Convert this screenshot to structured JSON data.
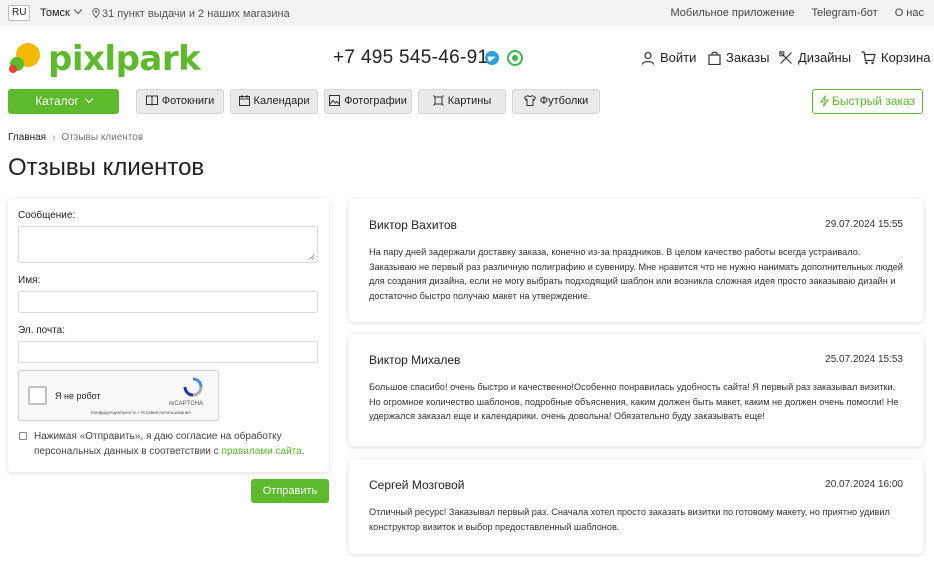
{
  "topbar": {
    "lang": "RU",
    "city": "Томск",
    "pickup": "31 пункт выдачи и 2 наших магазина",
    "links": [
      "Мобильное приложение",
      "Telegram-бот",
      "О нас"
    ]
  },
  "header": {
    "logo": "pixlpark",
    "phone": "+7 495 545-46-91",
    "nav": [
      "Войти",
      "Заказы",
      "Дизайны",
      "Корзина"
    ]
  },
  "catbar": {
    "catalog": "Каталог",
    "items": [
      "Фотокниги",
      "Календари",
      "Фотографии",
      "Картины",
      "Футболки"
    ],
    "quick_order": "Быстрый заказ"
  },
  "breadcrumb": {
    "home": "Главная",
    "current": "Отзывы клиентов"
  },
  "page_title": "Отзывы клиентов",
  "form": {
    "message_label": "Сообщение:",
    "name_label": "Имя:",
    "email_label": "Эл. почта:",
    "captcha_text": "Я не робот",
    "captcha_brand": "reCAPTCHA",
    "captcha_terms": "Конфиденциальность • Условия использования",
    "consent_text": "Нажимая «Отправить», я даю согласие на обработку персональных данных в соответствии с",
    "consent_link": "правилами сайта",
    "consent_end": ".",
    "submit": "Отправить"
  },
  "reviews": [
    {
      "name": "Виктор Вахитов",
      "date": "29.07.2024 15:55",
      "text": "На пару дней задержали доставку заказа, конечно из-за праздников. В целом качество работы всегда устраивало. Заказываю не первый раз различную полиграфию и сувениру. Мне нравится что не нужно нанимать дополнительных людей для создания дизайна, если не могу выбрать подходящий шаблон или возникла сложная идея просто заказываю дизайн и достаточно быстро получаю макет на утверждение."
    },
    {
      "name": "Виктор Михалев",
      "date": "25.07.2024 15:53",
      "text": "Большое спасибо! очень быстро и качественно!Особенно понравилась удобность сайта! Я первый раз заказывал визитки. Но огромное количество шаблонов, подробные объяснения, каким должен быть макет, каким не должен очень помогли! Не удержался заказал еще и календарики. очень довольна! Обязательно буду заказывать еще!"
    },
    {
      "name": "Сергей Мозговой",
      "date": "20.07.2024 16:00",
      "text": "Отличный ресурс! Заказывал первый раз. Сначала хотел просто заказать визитки по готовому макету, но приятно удивил конструктор визиток и выбор предоставленный шаблонов."
    }
  ],
  "colors": {
    "brand_green": "#5dba2c",
    "telegram": "#2aa0da",
    "whatsapp": "#3bb84a"
  }
}
